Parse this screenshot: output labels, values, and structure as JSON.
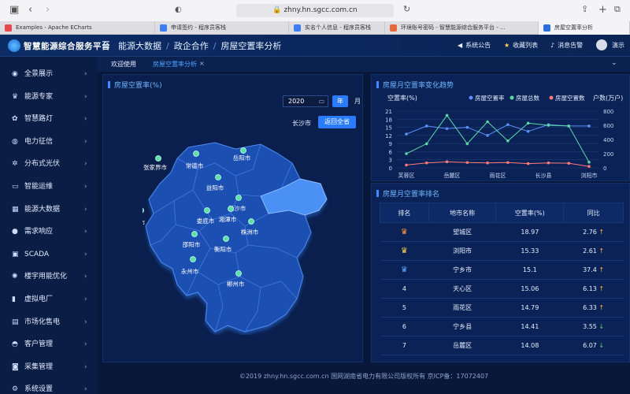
{
  "browser": {
    "url": "zhny.hn.sgcc.com.cn",
    "tabs": [
      {
        "label": "Examples - Apache ECharts",
        "color": "#e5484d"
      },
      {
        "label": "申请签约 - 程序员客栈",
        "color": "#3d7cf2"
      },
      {
        "label": "实名个人信息 - 程序员客栈",
        "color": "#3d7cf2"
      },
      {
        "label": "环境账号密码 - 智慧能源综合服务平台 - ...",
        "color": "#e5673b"
      },
      {
        "label": "房屋空置率分析",
        "color": "#2a6fdc"
      }
    ]
  },
  "header": {
    "app_title": "智慧能源综合服务平台",
    "crumb": [
      "能源大数据",
      "政企合作",
      "房屋空置率分析"
    ],
    "notice": "系统公告",
    "favorites": "收藏列表",
    "alerts": "消息告警",
    "user": "演示"
  },
  "sidebar": {
    "items": [
      {
        "label": "全景展示",
        "icon": "globe-icon",
        "glyph": "◉"
      },
      {
        "label": "能源专家",
        "icon": "trophy-icon",
        "glyph": "♛"
      },
      {
        "label": "智慧路灯",
        "icon": "lamp-icon",
        "glyph": "✿"
      },
      {
        "label": "电力征信",
        "icon": "credit-icon",
        "glyph": "◍"
      },
      {
        "label": "分布式光伏",
        "icon": "solar-icon",
        "glyph": "✲"
      },
      {
        "label": "智能运维",
        "icon": "monitor-icon",
        "glyph": "▭"
      },
      {
        "label": "能源大数据",
        "icon": "data-icon",
        "glyph": "▦"
      },
      {
        "label": "需求响应",
        "icon": "bulb-icon",
        "glyph": "●"
      },
      {
        "label": "SCADA",
        "icon": "scada-icon",
        "glyph": "▣"
      },
      {
        "label": "楼宇用能优化",
        "icon": "building-icon",
        "glyph": "✺"
      },
      {
        "label": "虚拟电厂",
        "icon": "plant-icon",
        "glyph": "▮"
      },
      {
        "label": "市场化售电",
        "icon": "market-icon",
        "glyph": "▤"
      },
      {
        "label": "客户管理",
        "icon": "customer-icon",
        "glyph": "◓"
      },
      {
        "label": "采集管理",
        "icon": "camera-icon",
        "glyph": "◙"
      },
      {
        "label": "系统设置",
        "icon": "settings-icon",
        "glyph": "⚙"
      }
    ]
  },
  "subtabs": {
    "welcome": "欢迎使用",
    "current": "房屋空置率分析",
    "close": "×"
  },
  "map_panel": {
    "title": "房屋空置率(%)",
    "year_value": "2020",
    "year_btn": "年",
    "month_btn": "月",
    "region": "长沙市",
    "return_btn": "返回全省",
    "cities": [
      "张家界市",
      "常德市",
      "岳阳市",
      "益阳市",
      "长沙市",
      "湘西州",
      "怀化市",
      "娄底市",
      "湘潭市",
      "株洲市",
      "邵阳市",
      "衡阳市",
      "永州市",
      "郴州市"
    ]
  },
  "trend_panel": {
    "title": "房屋月空置率变化趋势",
    "legend": [
      {
        "name": "房屋空置率",
        "color": "#5b8ff9"
      },
      {
        "name": "房屋总数",
        "color": "#5ad8a6"
      },
      {
        "name": "房屋空置数",
        "color": "#ff7a7a"
      }
    ],
    "left_axis_title": "空置率(%)",
    "right_axis_title": "户数(万户)",
    "left_ticks": [
      "21",
      "18",
      "15",
      "12",
      "9",
      "6",
      "3",
      "0"
    ],
    "right_ticks": [
      "800",
      "600",
      "400",
      "200",
      "0"
    ],
    "x_labels": [
      "芙蓉区",
      "岳麓区",
      "雨花区",
      "长沙县",
      "浏阳市"
    ]
  },
  "chart_data": {
    "type": "line",
    "x": [
      "芙蓉区",
      "",
      "岳麓区",
      "",
      "雨花区",
      "",
      "长沙县",
      "",
      "浏阳市",
      ""
    ],
    "series": [
      {
        "name": "房屋空置率",
        "axis": "left",
        "values": [
          12.5,
          15.5,
          14.5,
          15.0,
          12.0,
          16.0,
          13.5,
          16.0,
          15.5,
          15.5
        ]
      },
      {
        "name": "房屋总数",
        "axis": "right",
        "values": [
          200,
          340,
          740,
          340,
          650,
          380,
          630,
          600,
          590,
          80
        ]
      },
      {
        "name": "房屋空置数",
        "axis": "right",
        "values": [
          40,
          70,
          85,
          75,
          70,
          75,
          60,
          70,
          65,
          20
        ]
      }
    ],
    "ylim_left": [
      0,
      21
    ],
    "ylim_right": [
      0,
      800
    ]
  },
  "rank_panel": {
    "title": "房屋月空置率排名",
    "headers": [
      "排名",
      "地市名称",
      "空置率(%)",
      "同比"
    ],
    "rows": [
      {
        "rank": "1",
        "crown": "gold",
        "name": "望城区",
        "rate": "18.97",
        "yoy": "2.76",
        "dir": "↑"
      },
      {
        "rank": "2",
        "crown": "silver",
        "name": "浏阳市",
        "rate": "15.33",
        "yoy": "2.61",
        "dir": "↑"
      },
      {
        "rank": "3",
        "crown": "blue",
        "name": "宁乡市",
        "rate": "15.1",
        "yoy": "37.4",
        "dir": "↑"
      },
      {
        "rank": "4",
        "crown": "",
        "name": "天心区",
        "rate": "15.06",
        "yoy": "6.13",
        "dir": "↑"
      },
      {
        "rank": "5",
        "crown": "",
        "name": "雨花区",
        "rate": "14.79",
        "yoy": "6.33",
        "dir": "↑"
      },
      {
        "rank": "6",
        "crown": "",
        "name": "宁乡县",
        "rate": "14.41",
        "yoy": "3.55",
        "dir": "↓"
      },
      {
        "rank": "7",
        "crown": "",
        "name": "岳麓区",
        "rate": "14.08",
        "yoy": "6.07",
        "dir": "↓"
      }
    ]
  },
  "footer": "©2019 zhny.hn.sgcc.com.cn 国网湖南省电力有限公司版权所有 京ICP备：17072407"
}
